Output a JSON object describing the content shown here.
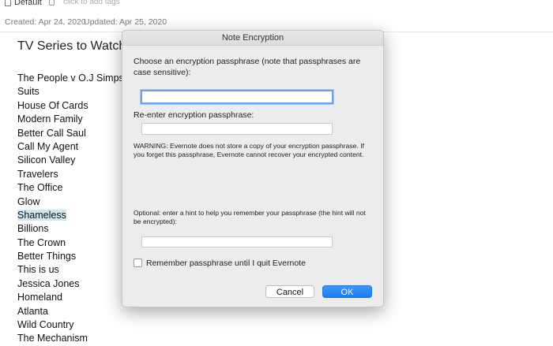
{
  "header": {
    "notebook_name": "Default",
    "tags_placeholder": "click to add tags",
    "created": "Created: Apr 24, 2020",
    "updated": "Updated: Apr 25, 2020"
  },
  "note": {
    "title": "TV Series to Watch",
    "items": [
      "The People v O.J Simpson",
      "Suits",
      "House Of Cards",
      "Modern Family",
      "Better Call Saul",
      "Call My Agent",
      "Silicon Valley",
      "Travelers",
      "The Office",
      "Glow",
      "Shameless",
      "Billions",
      "The Crown",
      "Better Things",
      "This is us",
      "Jessica Jones",
      "Homeland",
      "Atlanta",
      "Wild Country",
      "The Mechanism"
    ],
    "selected_item": "Shameless"
  },
  "dialog": {
    "title": "Note Encryption",
    "choose_label": "Choose an encryption passphrase (note that passphrases are case sensitive):",
    "passphrase_value": "",
    "reenter_label": "Re-enter encryption passphrase:",
    "reenter_value": "",
    "warning": "WARNING: Evernote does not store a copy of your encryption passphrase.  If you forget this passphrase, Evernote cannot recover your encrypted content.",
    "hint_label": "Optional: enter a hint to help you remember your passphrase (the hint will not be encrypted):",
    "hint_value": "",
    "remember_label": "Remember passphrase until I quit Evernote",
    "remember_checked": false,
    "cancel_label": "Cancel",
    "ok_label": "OK"
  },
  "colors": {
    "ok_button": "#1c7cf0",
    "selection_highlight": "#cfe6f3",
    "focus_ring": "#6aa3e8"
  }
}
